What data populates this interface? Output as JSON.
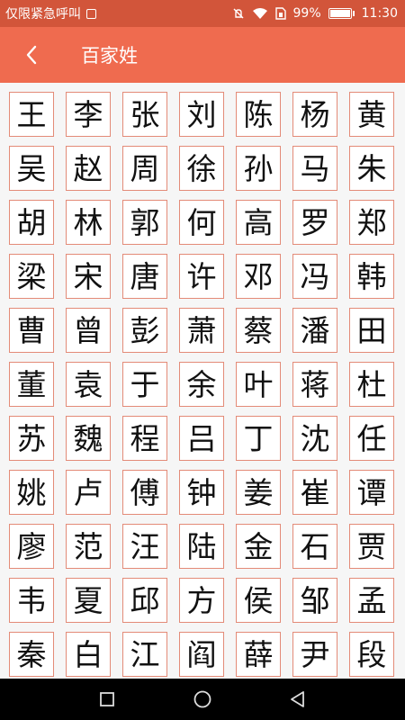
{
  "status_bar": {
    "carrier_text": "仅限紧急呼叫",
    "battery_percent": "99%",
    "time": "11:30",
    "icons": [
      "sim-card-icon",
      "mute-icon",
      "wifi-icon",
      "sim-status-icon",
      "battery-icon"
    ]
  },
  "app_bar": {
    "title": "百家姓",
    "back_icon": "chevron-left-icon",
    "color": "#ef6b4f"
  },
  "surnames": [
    "王",
    "李",
    "张",
    "刘",
    "陈",
    "杨",
    "黄",
    "吴",
    "赵",
    "周",
    "徐",
    "孙",
    "马",
    "朱",
    "胡",
    "林",
    "郭",
    "何",
    "高",
    "罗",
    "郑",
    "梁",
    "宋",
    "唐",
    "许",
    "邓",
    "冯",
    "韩",
    "曹",
    "曾",
    "彭",
    "萧",
    "蔡",
    "潘",
    "田",
    "董",
    "袁",
    "于",
    "余",
    "叶",
    "蒋",
    "杜",
    "苏",
    "魏",
    "程",
    "吕",
    "丁",
    "沈",
    "任",
    "姚",
    "卢",
    "傅",
    "钟",
    "姜",
    "崔",
    "谭",
    "廖",
    "范",
    "汪",
    "陆",
    "金",
    "石",
    "贾",
    "韦",
    "夏",
    "邱",
    "方",
    "侯",
    "邹",
    "孟",
    "秦",
    "白",
    "江",
    "阎",
    "薛",
    "尹",
    "段"
  ],
  "nav_bar": {
    "icons": [
      "recent-apps-icon",
      "home-icon",
      "back-icon"
    ]
  }
}
